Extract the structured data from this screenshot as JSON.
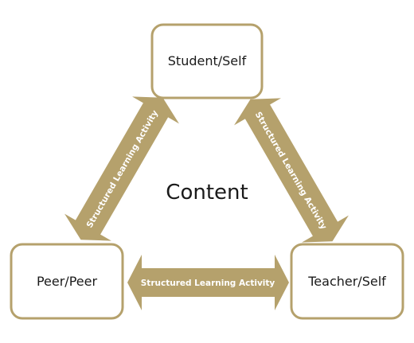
{
  "diagram": {
    "center_label": "Content",
    "nodes": {
      "top": "Student/Self",
      "left": "Peer/Peer",
      "right": "Teacher/Self"
    },
    "arrows": {
      "left": "Structured Learning Activity",
      "right": "Structured Learning Activity",
      "bottom": "Structured Learning Activity"
    }
  },
  "colors": {
    "accent": "#b5a16c",
    "text": "#1a1a1a",
    "arrow_text": "#ffffff"
  }
}
